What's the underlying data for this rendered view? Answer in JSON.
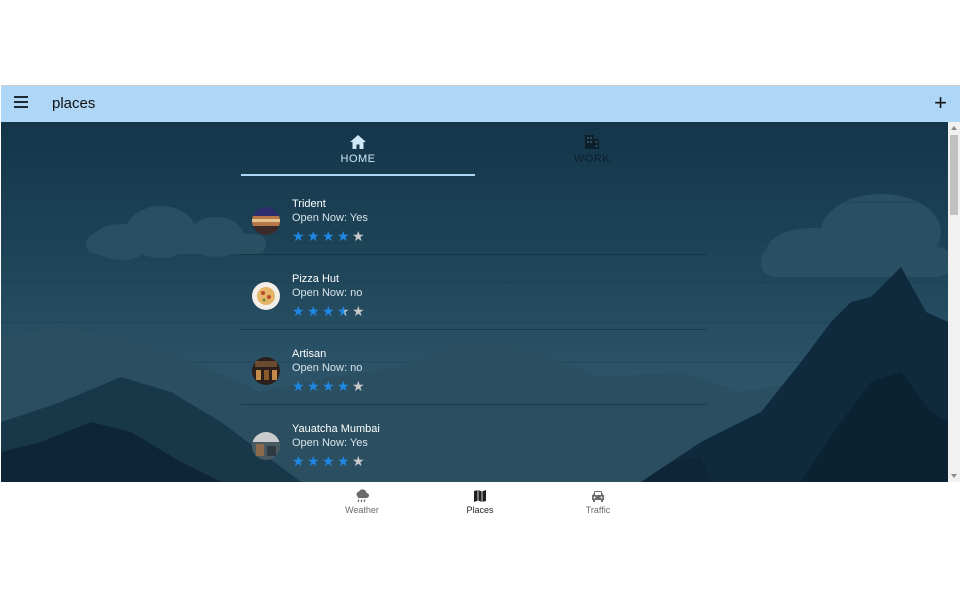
{
  "app": {
    "title": "places"
  },
  "tabs": [
    {
      "label": "HOME",
      "icon": "home-icon",
      "active": true
    },
    {
      "label": "WORK",
      "icon": "building-icon",
      "active": false
    }
  ],
  "places": [
    {
      "name": "Trident",
      "open_text": "Open Now: Yes",
      "rating": 4,
      "max_rating": 5
    },
    {
      "name": "Pizza Hut",
      "open_text": "Open Now: no",
      "rating": 3.5,
      "max_rating": 5
    },
    {
      "name": "Artisan",
      "open_text": "Open Now: no",
      "rating": 4,
      "max_rating": 5
    },
    {
      "name": "Yauatcha Mumbai",
      "open_text": "Open Now: Yes",
      "rating": 4,
      "max_rating": 5
    }
  ],
  "bottom_nav": [
    {
      "label": "Weather",
      "icon": "weather-cloud-icon",
      "active": false
    },
    {
      "label": "Places",
      "icon": "map-icon",
      "active": true
    },
    {
      "label": "Traffic",
      "icon": "car-icon",
      "active": false
    }
  ],
  "colors": {
    "appbar": "#aed6f6",
    "star_full": "#1e88e5",
    "star_empty": "#c9c9c9"
  }
}
